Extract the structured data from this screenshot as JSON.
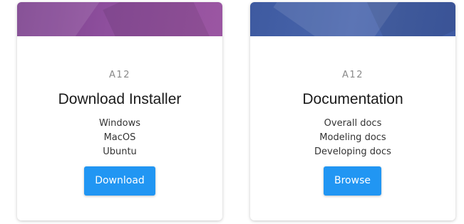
{
  "cards": [
    {
      "code": "A12",
      "title": "Download Installer",
      "items": [
        "Windows",
        "MacOS",
        "Ubuntu"
      ],
      "button_label": "Download"
    },
    {
      "code": "A12",
      "title": "Documentation",
      "items": [
        "Overall docs",
        "Modeling docs",
        "Developing docs"
      ],
      "button_label": "Browse"
    }
  ],
  "colors": {
    "button": "#2196f3",
    "banner_left": "#8e4f9d",
    "banner_right": "#4a66ad"
  }
}
